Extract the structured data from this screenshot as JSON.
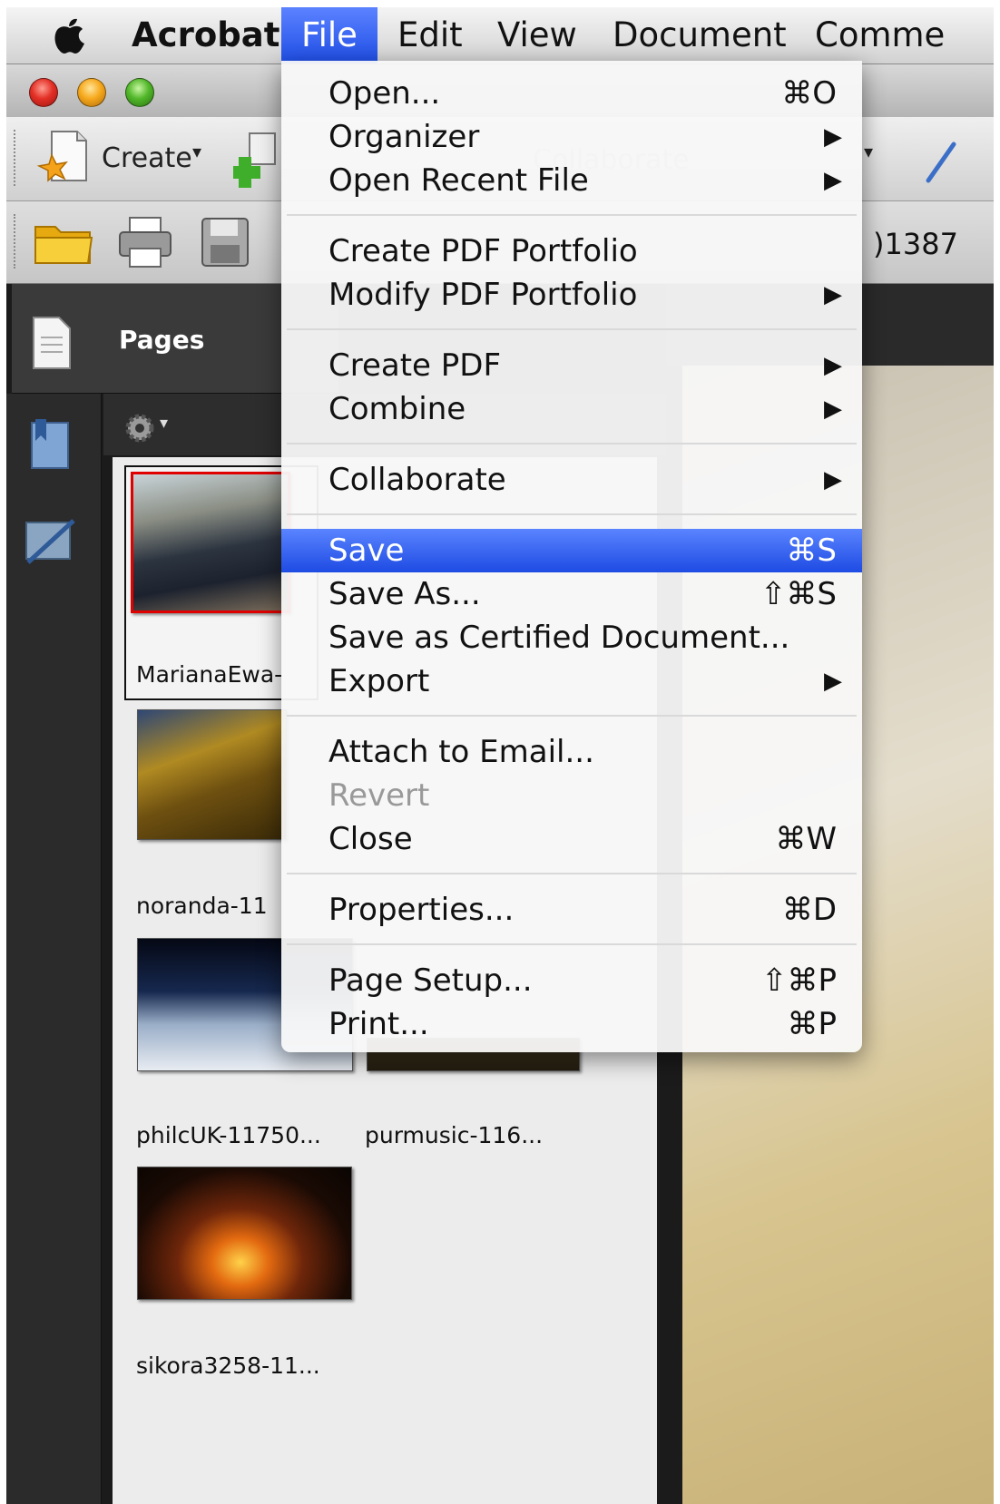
{
  "menubar": {
    "app_name": "Acrobat",
    "items": [
      "File",
      "Edit",
      "View",
      "Document",
      "Comme"
    ]
  },
  "toolbar": {
    "create_label": "Create",
    "address_fragment": ")1387"
  },
  "panel": {
    "title": "Pages"
  },
  "thumbnails": [
    {
      "caption": "MarianaEwa-"
    },
    {
      "caption": "noranda-11"
    },
    {
      "caption": "philcUK-11750..."
    },
    {
      "caption": "purmusic-116..."
    },
    {
      "caption": "sikora3258-11..."
    }
  ],
  "file_menu": {
    "groups": [
      [
        {
          "label": "Open...",
          "shortcut": "⌘O"
        },
        {
          "label": "Organizer",
          "submenu": "▶"
        },
        {
          "label": "Open Recent File",
          "submenu": "▶"
        }
      ],
      [
        {
          "label": "Create PDF Portfolio"
        },
        {
          "label": "Modify PDF Portfolio",
          "submenu": "▶"
        }
      ],
      [
        {
          "label": "Create PDF",
          "submenu": "▶"
        },
        {
          "label": "Combine",
          "submenu": "▶"
        }
      ],
      [
        {
          "label": "Collaborate",
          "submenu": "▶"
        }
      ],
      [
        {
          "label": "Save",
          "shortcut": "⌘S",
          "highlighted": true
        },
        {
          "label": "Save As...",
          "shortcut": "⇧⌘S"
        },
        {
          "label": "Save as Certified Document..."
        },
        {
          "label": "Export",
          "submenu": "▶"
        }
      ],
      [
        {
          "label": "Attach to Email..."
        },
        {
          "label": "Revert",
          "disabled": true
        },
        {
          "label": "Close",
          "shortcut": "⌘W"
        }
      ],
      [
        {
          "label": "Properties...",
          "shortcut": "⌘D"
        }
      ],
      [
        {
          "label": "Page Setup...",
          "shortcut": "⇧⌘P"
        },
        {
          "label": "Print...",
          "shortcut": "⌘P"
        }
      ]
    ]
  },
  "colors": {
    "highlight": "#2a57ef",
    "menubar_bg": "#e4e4e4",
    "panel_dark": "#2b2b2b"
  }
}
